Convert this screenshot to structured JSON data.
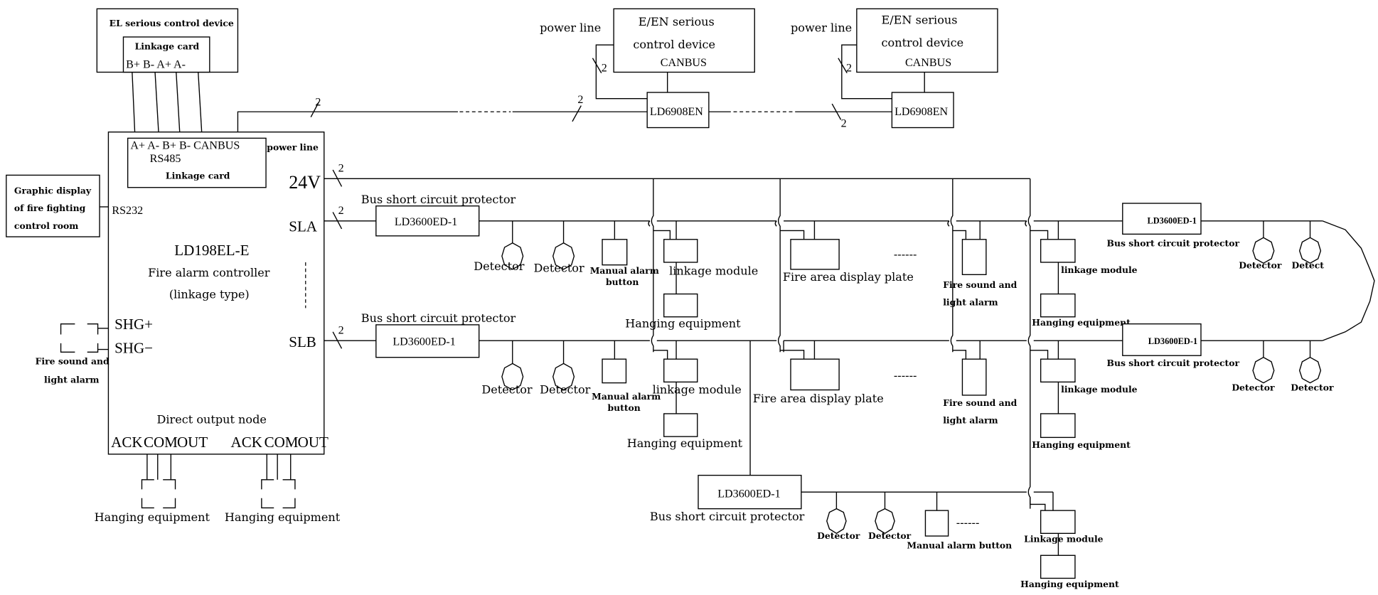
{
  "el_device": {
    "title": "EL serious control device",
    "card_label": "Linkage card",
    "terminals": "B+  B-  A+  A-"
  },
  "controller": {
    "model": "LD198EL-E",
    "name": "Fire alarm controller",
    "type": "(linkage type)",
    "card_terminals": "A+  A-  B+  B-  CANBUS",
    "card_rs485": "RS485",
    "card_label": "Linkage card",
    "power_line": "power line",
    "port_24v": "24V",
    "port_sla": "SLA",
    "port_slb": "SLB",
    "port_rs232": "RS232",
    "port_shg_plus": "SHG+",
    "port_shg_minus": "SHG−",
    "direct_output": "Direct output node",
    "outputs": [
      "ACK",
      "COM",
      "OUT",
      "ACK",
      "COM",
      "OUT"
    ]
  },
  "graphic_display": {
    "lines": [
      "Graphic display",
      "of fire fighting",
      "control room"
    ]
  },
  "left_alarm": {
    "line1": "Fire sound   and",
    "line2": "light  alarm"
  },
  "hanging_left": [
    "Hanging equipment",
    "Hanging equipment"
  ],
  "canbus": {
    "wire_count": "2",
    "devices": [
      {
        "power": "power line",
        "title1": "E/EN serious",
        "title2": "control device",
        "title3": "CANBUS",
        "node": "LD6908EN"
      },
      {
        "power": "power line",
        "title1": "E/EN serious",
        "title2": "control device",
        "title3": "CANBUS",
        "node": "LD6908EN"
      }
    ]
  },
  "bus": {
    "protector_model": "LD3600ED-1",
    "protector_label": "Bus short circuit protector",
    "detector": "Detector",
    "detector_cut": "Detect",
    "manual1": "Manual alarm",
    "manual2": "button",
    "manual_full": "Manual alarm button",
    "linkage_module": "linkage module",
    "linkage_module_cap": "Linkage module",
    "hanging": "Hanging equipment",
    "fire_area": "Fire area display plate",
    "alarm1": "Fire sound  and",
    "alarm2": "light  alarm",
    "ellipsis": "------"
  }
}
